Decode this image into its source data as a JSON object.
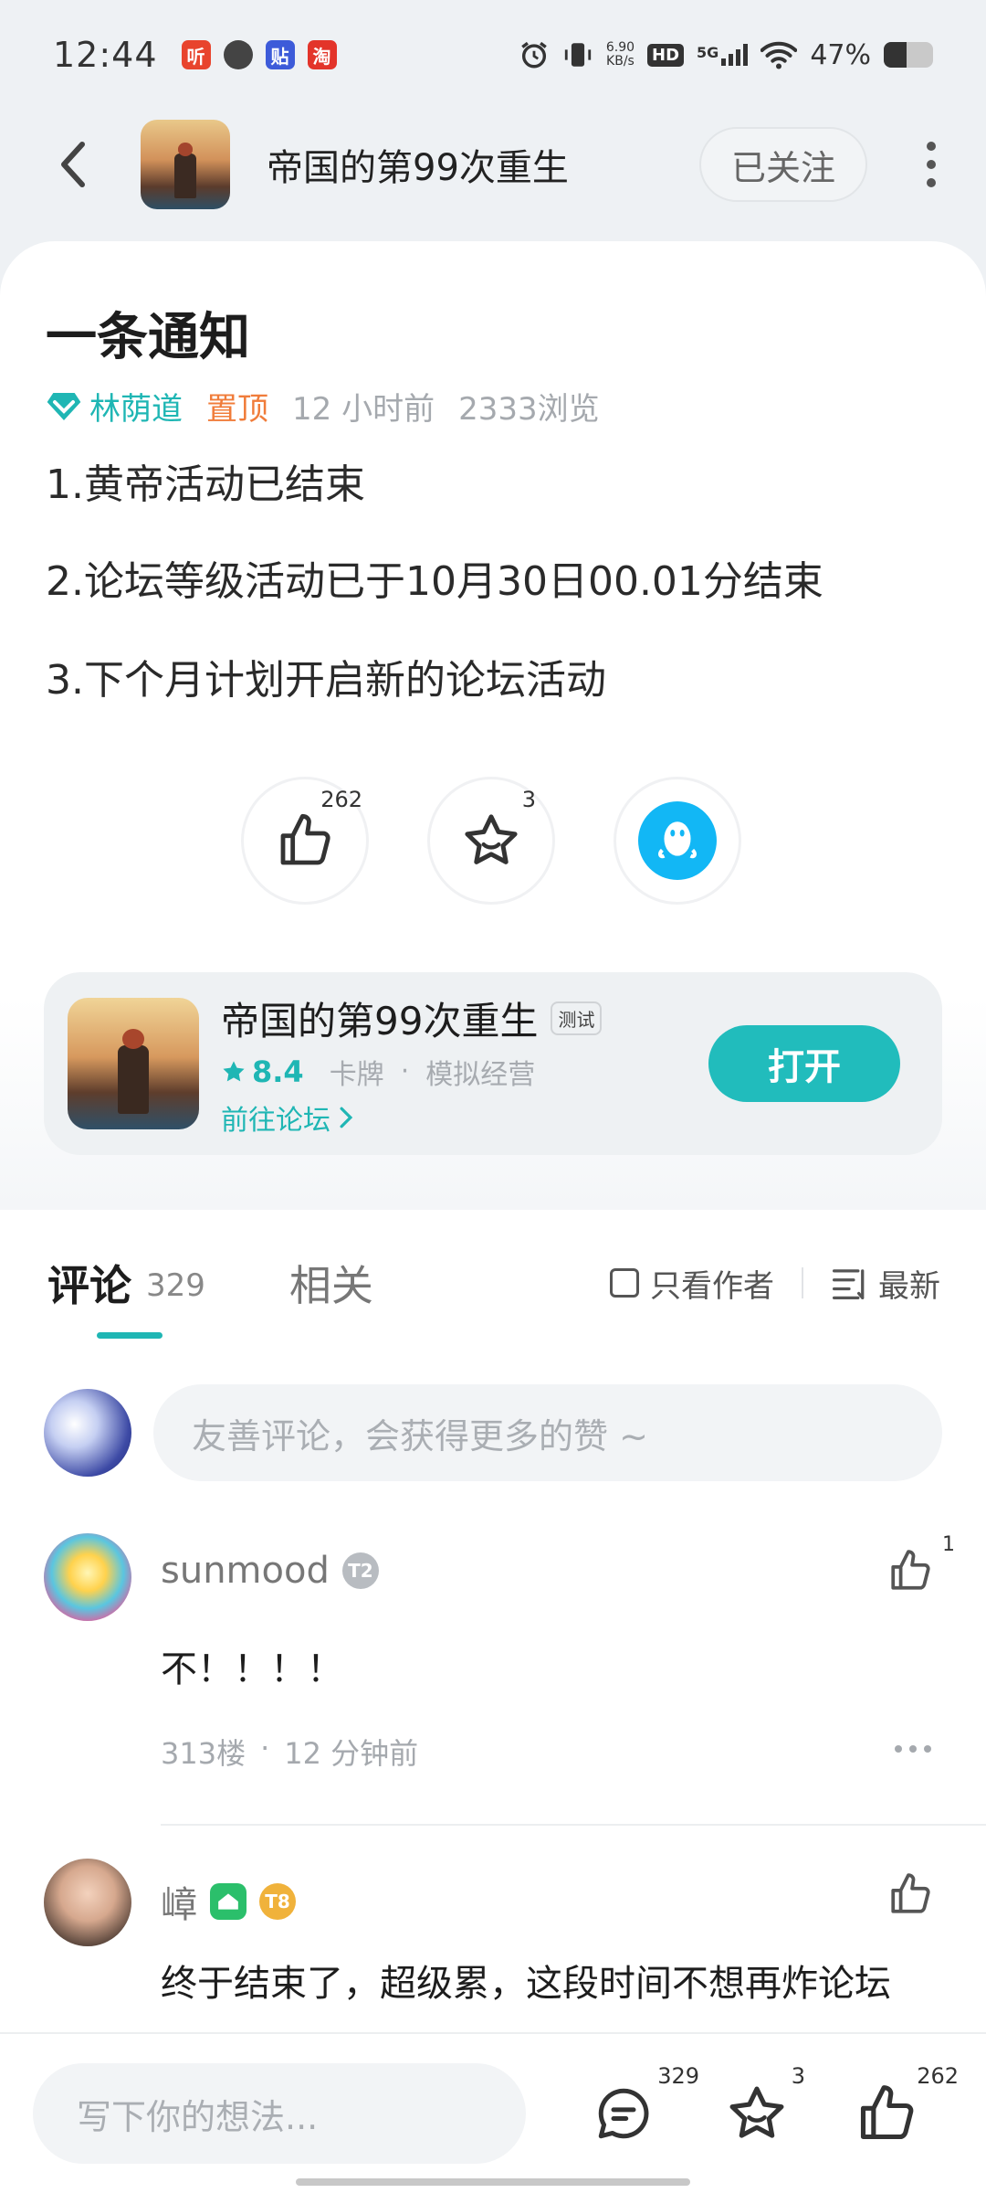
{
  "status_bar": {
    "time": "12:44",
    "apps": [
      "听",
      "贴",
      "贴",
      "淘"
    ],
    "speed_value": "6.90",
    "speed_unit": "KB/s",
    "hd_label": "HD",
    "network": "5G",
    "battery_text": "47%",
    "battery_level": 0.47
  },
  "header": {
    "title": "帝国的第99次重生",
    "follow_label": "已关注"
  },
  "post": {
    "title": "一条通知",
    "author": "林荫道",
    "pinned_label": "置顶",
    "time_ago": "12 小时前",
    "views": "2333浏览",
    "lines": [
      "1.黄帝活动已结束",
      "2.论坛等级活动已于10月30日00.01分结束",
      "3.下个月计划开启新的论坛活动"
    ],
    "reactions": {
      "like_count": "262",
      "favorite_count": "3"
    }
  },
  "game_card": {
    "name": "帝国的第99次重生",
    "tag": "测试",
    "score": "8.4",
    "genre1": "卡牌",
    "separator": "·",
    "genre2": "模拟经营",
    "forum_link": "前往论坛",
    "open_label": "打开"
  },
  "comments_section": {
    "tab_comments": "评论",
    "comment_count": "329",
    "tab_related": "相关",
    "filter_author_only": "只看作者",
    "sort_label": "最新",
    "composer_placeholder": "友善评论，会获得更多的赞 ~"
  },
  "comments": [
    {
      "user": "sunmood",
      "badge_level": "T2",
      "like_count": "1",
      "text": "不！！！！",
      "floor": "313楼",
      "dot": "·",
      "time": "12 分钟前"
    },
    {
      "user": "嶂",
      "badge_level": "T8",
      "like_count": "",
      "text": "终于结束了，超级累，这段时间不想再炸论坛"
    }
  ],
  "bottom_bar": {
    "input_placeholder": "写下你的想法...",
    "comment_count": "329",
    "favorite_count": "3",
    "like_count": "262"
  },
  "colors": {
    "accent": "#1fb6b4",
    "pinned": "#f07c3a",
    "open_button": "#21bcbc"
  }
}
